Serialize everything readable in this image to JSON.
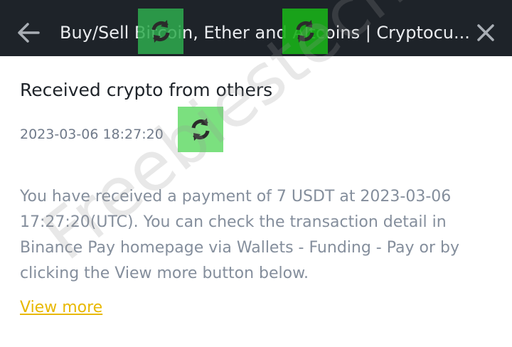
{
  "header": {
    "back_icon": "arrow-left-icon",
    "title": "Buy/Sell Bitcoin, Ether and Altcoins | Cryptocu...",
    "close_icon": "close-icon"
  },
  "message": {
    "title": "Received crypto from others",
    "timestamp": "2023-03-06 18:27:20",
    "body": "You have received a payment of 7 USDT at 2023-03-06 17:27:20(UTC). You can check the transaction detail in Binance Pay homepage via Wallets - Funding - Pay or by clicking the View more button below.",
    "link_label": "View more"
  },
  "watermark": {
    "text": "Freebiestech"
  },
  "colors": {
    "header_bg": "#1e2329",
    "link": "#e8b800",
    "body_text": "#848e9c",
    "sticker_green": "#2eac4e"
  }
}
